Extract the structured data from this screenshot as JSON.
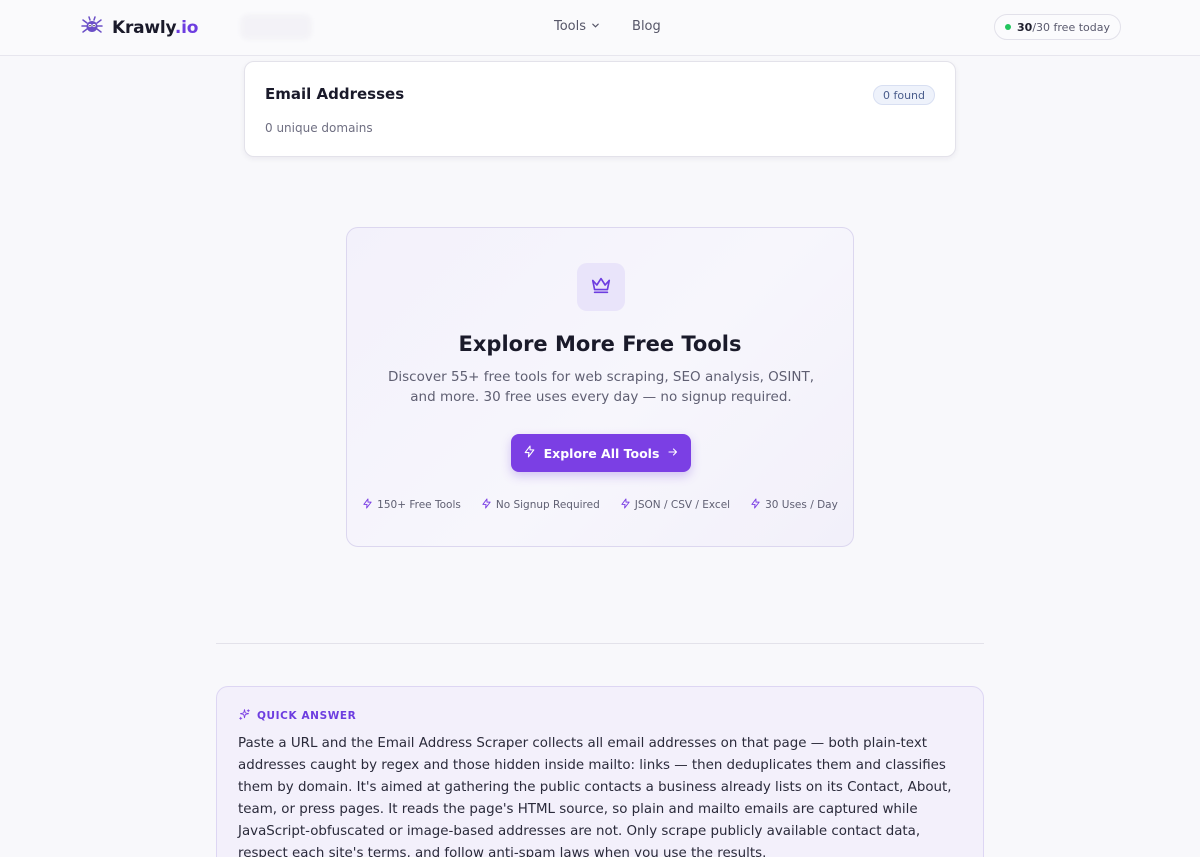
{
  "header": {
    "logo_text": "Krawly",
    "logo_accent": ".io",
    "nav": [
      {
        "label": "Tools",
        "has_dropdown": true
      },
      {
        "label": "Blog",
        "has_dropdown": false
      }
    ],
    "usage_count": "30",
    "usage_suffix": "/30 free today"
  },
  "email_card": {
    "title": "Email Addresses",
    "subtitle": "0 unique domains",
    "found_badge": "0 found"
  },
  "explore": {
    "title": "Explore More Free Tools",
    "description": "Discover 55+ free tools for web scraping, SEO analysis, OSINT, and more. 30 free uses every day — no signup required.",
    "button_label": "Explore All Tools",
    "features": [
      "150+ Free Tools",
      "No Signup Required",
      "JSON / CSV / Excel",
      "30 Uses / Day"
    ]
  },
  "quick_answer": {
    "label": "QUICK ANSWER",
    "text": "Paste a URL and the Email Address Scraper collects all email addresses on that page — both plain-text addresses caught by regex and those hidden inside mailto: links — then deduplicates them and classifies them by domain. It's aimed at gathering the public contacts a business already lists on its Contact, About, team, or press pages. It reads the page's HTML source, so plain and mailto emails are captured while JavaScript-obfuscated or image-based addresses are not. Only scrape publicly available contact data, respect each site's terms, and follow anti-spam laws when you use the results."
  },
  "colors": {
    "accent": "#7b3fe4",
    "status_dot": "#22c55e"
  },
  "icons": [
    "spider-logo-icon",
    "chevron-down-icon",
    "crown-icon",
    "bolt-icon",
    "arrow-right-icon",
    "sparkles-icon"
  ]
}
